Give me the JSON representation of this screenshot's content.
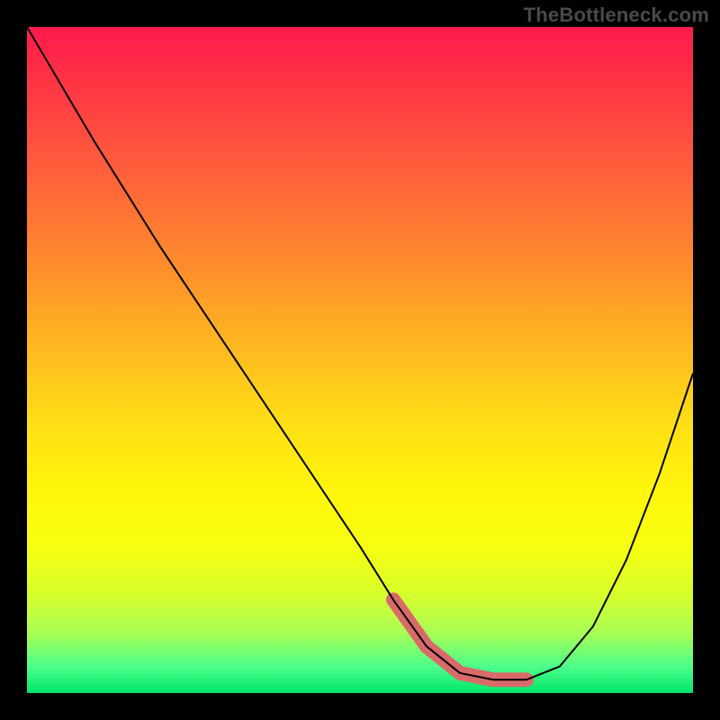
{
  "watermark": "TheBottleneck.com",
  "chart_data": {
    "type": "line",
    "title": "",
    "xlabel": "",
    "ylabel": "",
    "xlim": [
      0,
      100
    ],
    "ylim": [
      0,
      100
    ],
    "grid": false,
    "legend": false,
    "background": "red-yellow-green vertical gradient",
    "series": [
      {
        "name": "curve",
        "x": [
          0,
          10,
          20,
          30,
          40,
          50,
          55,
          60,
          65,
          70,
          75,
          80,
          85,
          90,
          95,
          100
        ],
        "values": [
          100,
          83,
          67,
          52,
          37,
          22,
          14,
          7,
          3,
          2,
          2,
          4,
          10,
          20,
          33,
          48
        ]
      }
    ],
    "accent_region": {
      "description": "highlighted segment near curve minimum",
      "x_start": 55,
      "x_end": 78,
      "color": "#d96a6a"
    },
    "gradient_stops": [
      {
        "pos": 0,
        "color": "#ff1a4d"
      },
      {
        "pos": 35,
        "color": "#ff8a2d"
      },
      {
        "pos": 70,
        "color": "#fff60a"
      },
      {
        "pos": 100,
        "color": "#00e56a"
      }
    ]
  }
}
